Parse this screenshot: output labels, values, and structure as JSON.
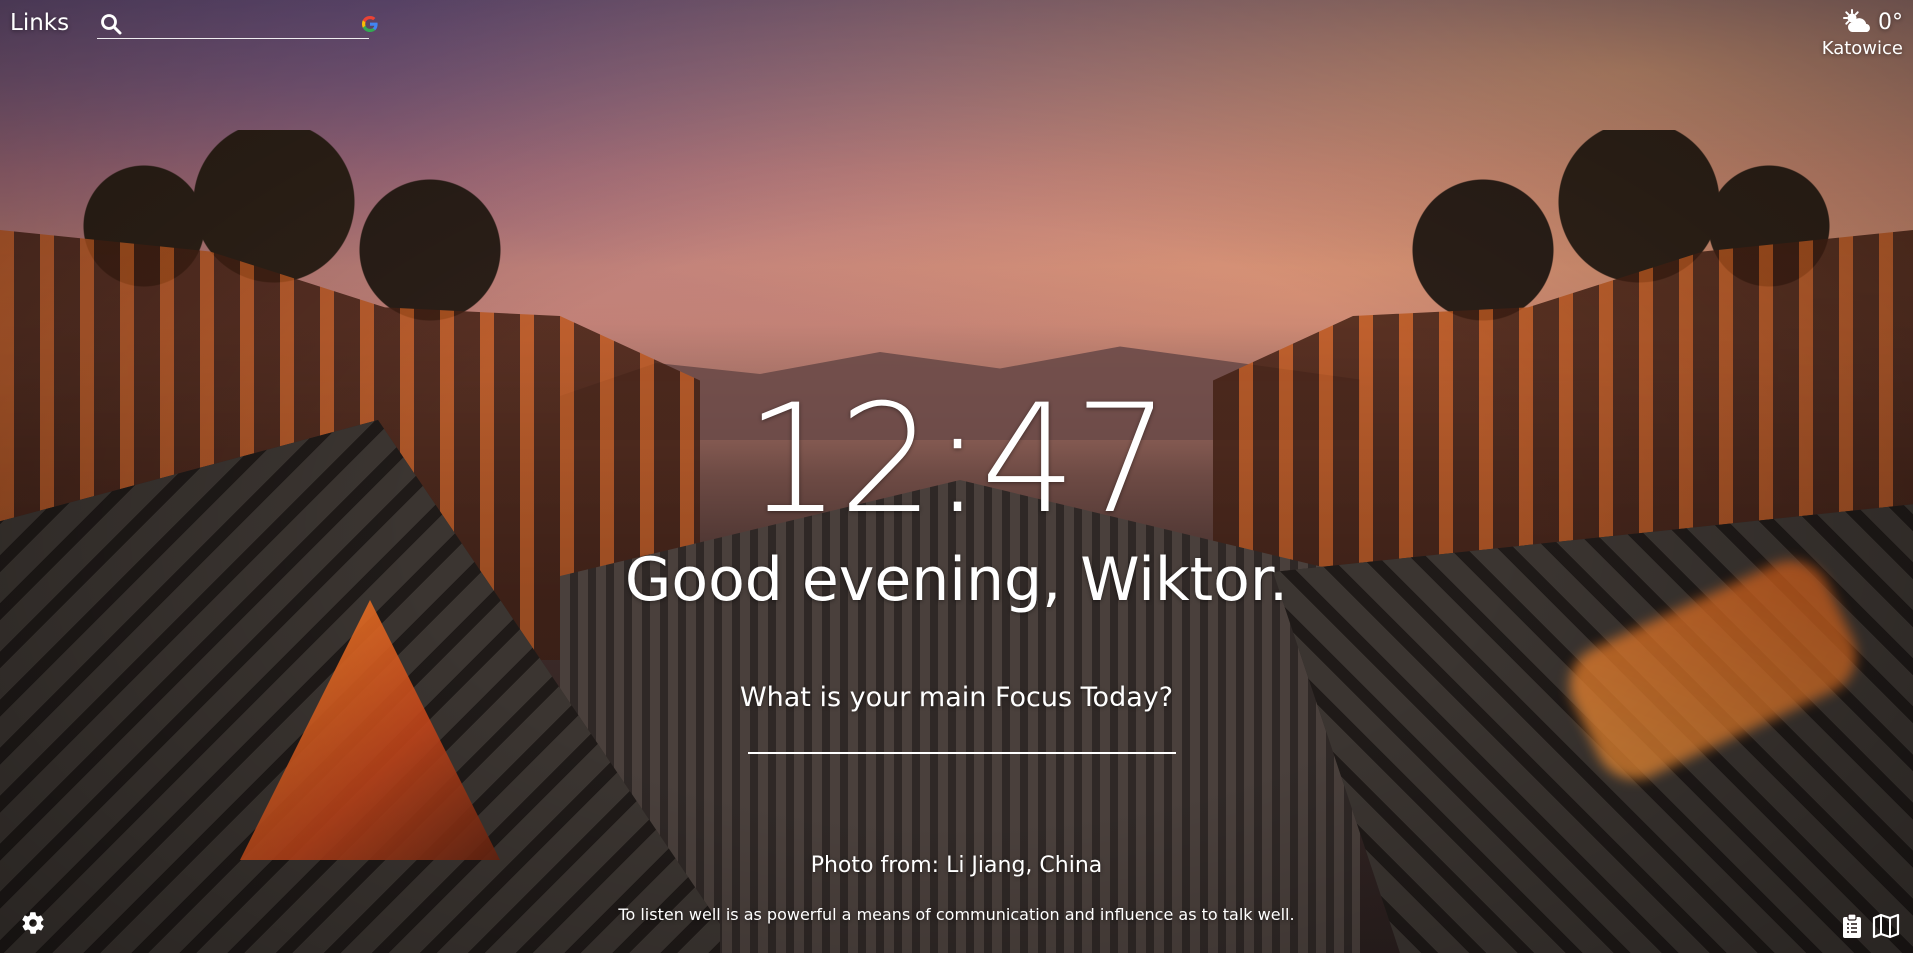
{
  "header": {
    "links_label": "Links",
    "search_placeholder": "",
    "search_engine_icon": "google-icon",
    "search_icon": "search-icon"
  },
  "weather": {
    "temperature": "0°",
    "city": "Katowice",
    "condition_icon": "partly-cloudy-sun-icon"
  },
  "main": {
    "time": "12:47",
    "greeting": "Good evening, Wiktor.",
    "focus_question": "What is your main Focus Today?",
    "focus_value": ""
  },
  "footer": {
    "photo_credit": "Photo from: Li Jiang, China",
    "quote": "To listen well is as powerful a means of communication and influence as to talk well.",
    "settings_icon": "gear-icon",
    "todo_icon": "clipboard-icon",
    "map_icon": "map-icon"
  },
  "colors": {
    "text": "#ffffff",
    "google_blue": "#4285F4",
    "google_red": "#EA4335",
    "google_yellow": "#FBBC05",
    "google_green": "#34A853"
  }
}
